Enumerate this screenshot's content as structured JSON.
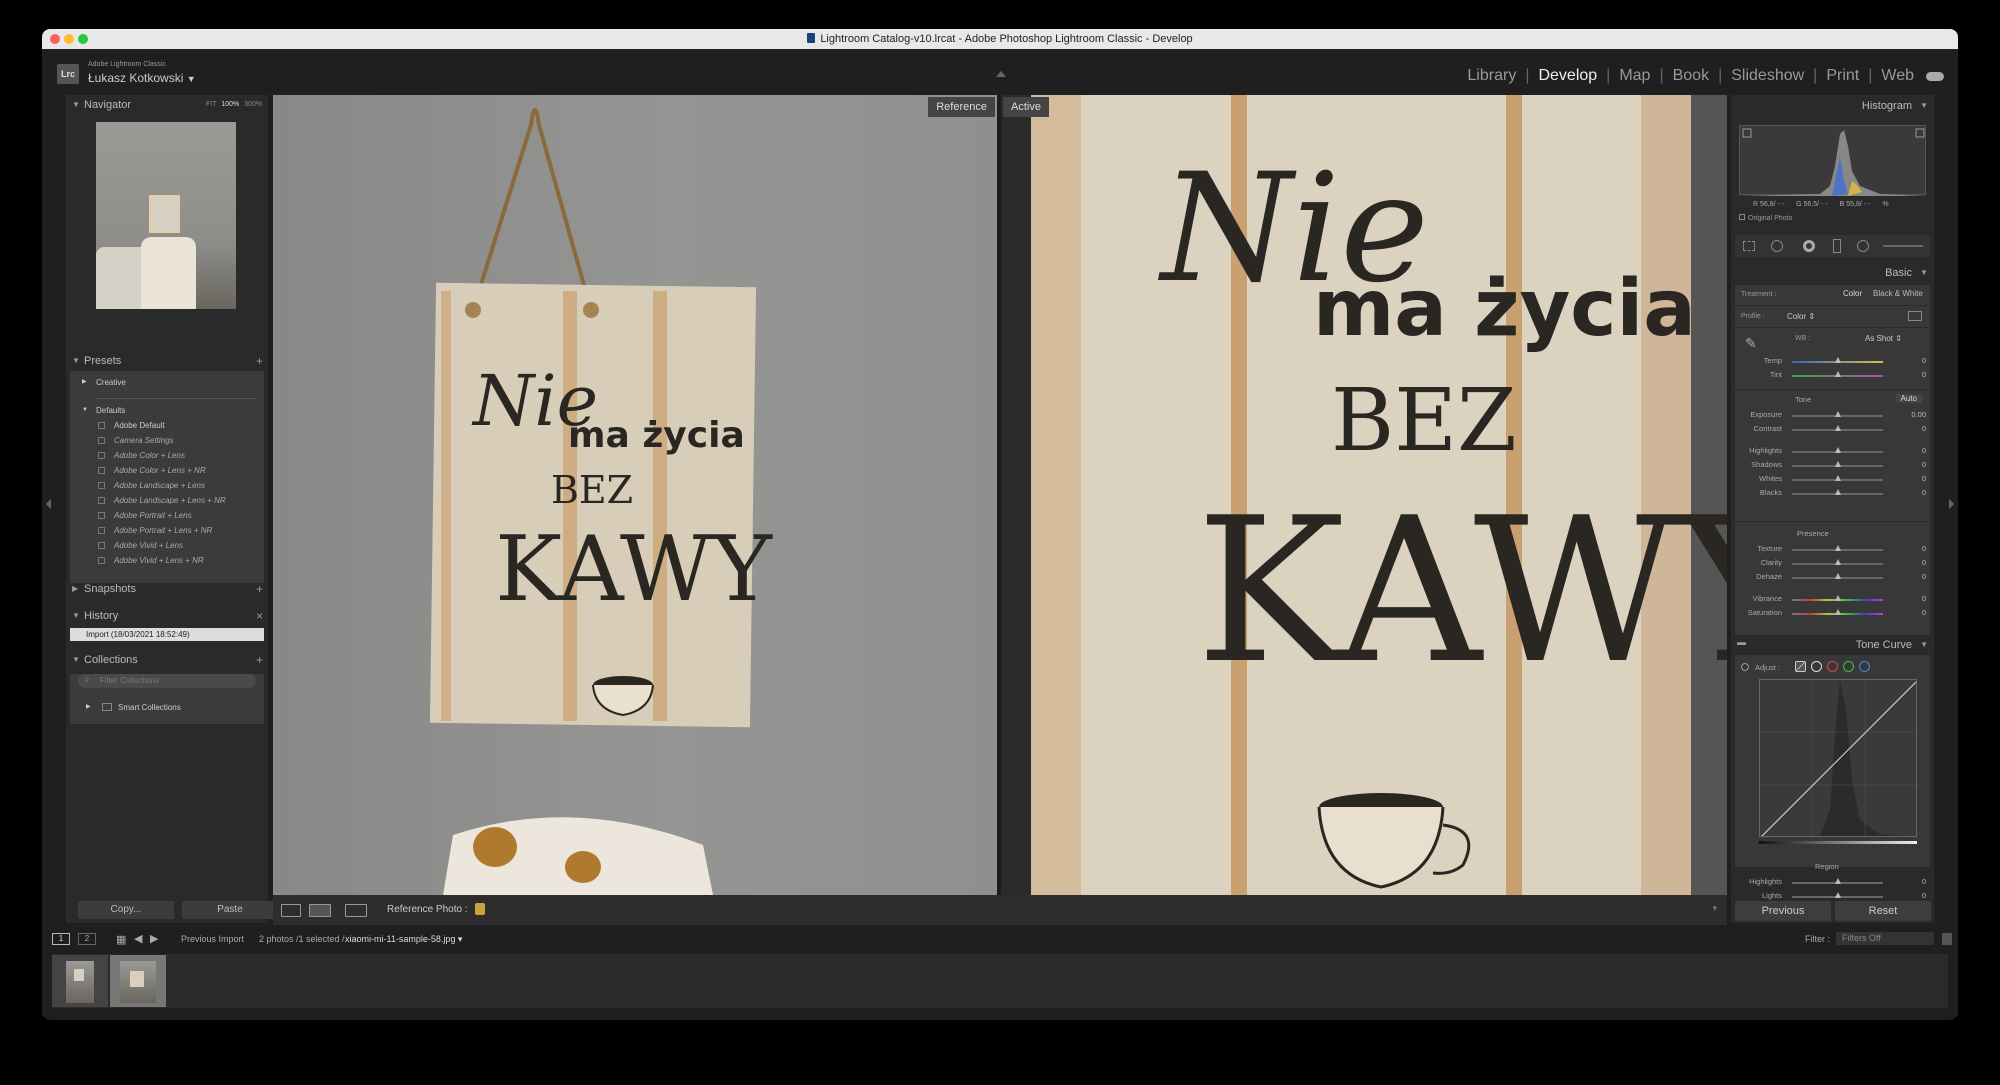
{
  "window": {
    "title": "Lightroom Catalog-v10.lrcat - Adobe Photoshop Lightroom Classic - Develop"
  },
  "identity": {
    "logo": "Lrc",
    "app": "Adobe Lightroom Classic",
    "user": "Łukasz Kotkowski"
  },
  "modules": [
    "Library",
    "Develop",
    "Map",
    "Book",
    "Slideshow",
    "Print",
    "Web"
  ],
  "active_module": "Develop",
  "navigator": {
    "title": "Navigator",
    "zoom": [
      "FIT",
      "100%",
      "300%"
    ]
  },
  "presets": {
    "title": "Presets",
    "groups": [
      {
        "name": "Creative",
        "items": []
      },
      {
        "name": "Defaults",
        "items": [
          "Adobe Default",
          "Camera Settings",
          "Adobe Color + Lens",
          "Adobe Color + Lens + NR",
          "Adobe Landscape + Lens",
          "Adobe Landscape + Lens + NR",
          "Adobe Portrait + Lens",
          "Adobe Portrait + Lens + NR",
          "Adobe Vivid + Lens",
          "Adobe Vivid + Lens + NR"
        ]
      }
    ]
  },
  "snapshots": {
    "title": "Snapshots"
  },
  "history": {
    "title": "History",
    "items": [
      "Import (18/03/2021 18:52:49)"
    ]
  },
  "collections": {
    "title": "Collections",
    "filter_placeholder": "Filter Collections",
    "items": [
      "Smart Collections"
    ]
  },
  "left_buttons": {
    "copy": "Copy...",
    "paste": "Paste"
  },
  "viewer": {
    "reference_label": "Reference",
    "active_label": "Active",
    "sign_text": {
      "line1": "Nie",
      "line2": "ma życia",
      "line3": "BEZ",
      "line4": "KAWY"
    }
  },
  "toolbar": {
    "reference_photo_label": "Reference Photo :"
  },
  "histogram": {
    "title": "Histogram",
    "readout": {
      "r": "R 56,8/ - -",
      "g": "G 56,5/ - -",
      "b": "B 55,8/ - -",
      "pct": "%"
    },
    "original_photo": "Original Photo"
  },
  "basic": {
    "title": "Basic",
    "treatment_label": "Treatment :",
    "treatment_options": [
      "Color",
      "Black & White"
    ],
    "profile_label": "Profile :",
    "profile_value": "Color",
    "wb_label": "WB :",
    "wb_value": "As Shot",
    "wb_sliders": [
      {
        "label": "Temp",
        "value": "0",
        "pos": 0.5
      },
      {
        "label": "Tint",
        "value": "0",
        "pos": 0.5
      }
    ],
    "tone_label": "Tone",
    "auto_label": "Auto",
    "tone_sliders": [
      {
        "label": "Exposure",
        "value": "0.00",
        "pos": 0.5
      },
      {
        "label": "Contrast",
        "value": "0",
        "pos": 0.5
      },
      {
        "label": "Highlights",
        "value": "0",
        "pos": 0.5
      },
      {
        "label": "Shadows",
        "value": "0",
        "pos": 0.5
      },
      {
        "label": "Whites",
        "value": "0",
        "pos": 0.5
      },
      {
        "label": "Blacks",
        "value": "0",
        "pos": 0.5
      }
    ],
    "presence_label": "Presence",
    "presence_sliders": [
      {
        "label": "Texture",
        "value": "0",
        "pos": 0.5
      },
      {
        "label": "Clarity",
        "value": "0",
        "pos": 0.5
      },
      {
        "label": "Dehaze",
        "value": "0",
        "pos": 0.5
      },
      {
        "label": "Vibrance",
        "value": "0",
        "pos": 0.5
      },
      {
        "label": "Saturation",
        "value": "0",
        "pos": 0.5
      }
    ]
  },
  "tone_curve": {
    "title": "Tone Curve",
    "adjust_label": "Adjust :",
    "region_label": "Region",
    "region_sliders": [
      {
        "label": "Highlights",
        "value": "0",
        "pos": 0.5
      },
      {
        "label": "Lights",
        "value": "0",
        "pos": 0.5
      }
    ]
  },
  "right_buttons": {
    "previous": "Previous",
    "reset": "Reset"
  },
  "filmbar": {
    "monitor1": "1",
    "monitor2": "2",
    "source": "Previous Import",
    "count": "2 photos /1 selected /",
    "filename": "xiaomi-mi-11-sample-58.jpg",
    "filter_label": "Filter :",
    "filter_value": "Filters Off"
  },
  "colors": {
    "panel": "#2a2a2a",
    "accent_active_text": "#eeeeee",
    "bg": "#1f1f1f"
  }
}
